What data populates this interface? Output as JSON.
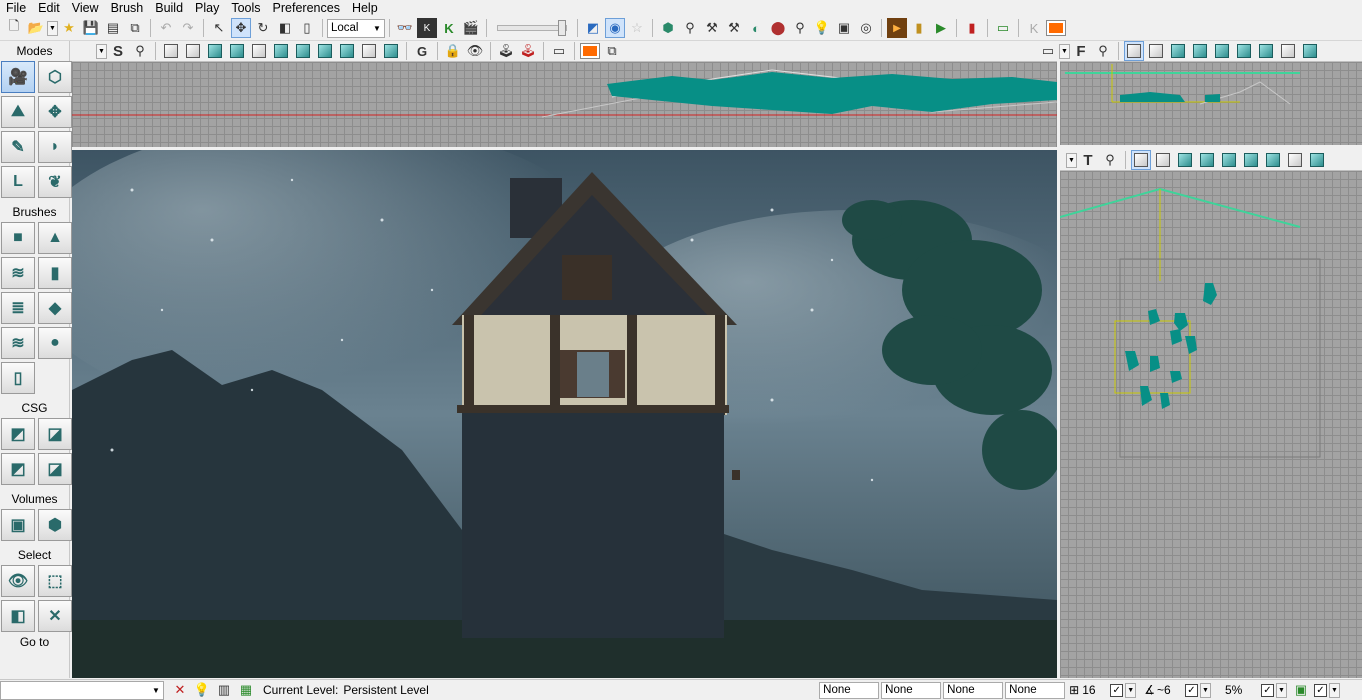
{
  "menu": [
    "File",
    "Edit",
    "View",
    "Brush",
    "Build",
    "Play",
    "Tools",
    "Preferences",
    "Help"
  ],
  "toolbar": {
    "coord_system": "Local"
  },
  "left_panel": {
    "sections": [
      {
        "label": "Modes",
        "buttons": [
          "camera-mode",
          "geometry-mode",
          "terrain-mode",
          "move-widget",
          "texture-align",
          "static-mesh",
          "landscape",
          "foliage"
        ]
      },
      {
        "label": "Brushes",
        "buttons": [
          "cube-brush",
          "cone-brush",
          "curved-stair",
          "cylinder-brush",
          "linear-stair",
          "sheet-brush",
          "spiral-stair",
          "sphere-brush",
          "volumetric-brush"
        ]
      },
      {
        "label": "CSG",
        "buttons": [
          "csg-add",
          "csg-subtract",
          "csg-intersect",
          "csg-deintersect"
        ]
      },
      {
        "label": "Volumes",
        "buttons": [
          "add-volume",
          "volume-list"
        ]
      },
      {
        "label": "Select",
        "buttons": [
          "show-selected",
          "hide-selected",
          "select-invert",
          "select-none"
        ]
      }
    ],
    "goto_label": "Go to"
  },
  "viewports": {
    "side_letter": "S",
    "front_letter": "F",
    "top_letter": "T"
  },
  "statusbar": {
    "current_level_label": "Current Level:",
    "current_level": "Persistent Level",
    "fields": [
      "None",
      "None",
      "None",
      "None"
    ],
    "grid_value": "16",
    "rot_value": "~6",
    "scale_value": "5%"
  }
}
